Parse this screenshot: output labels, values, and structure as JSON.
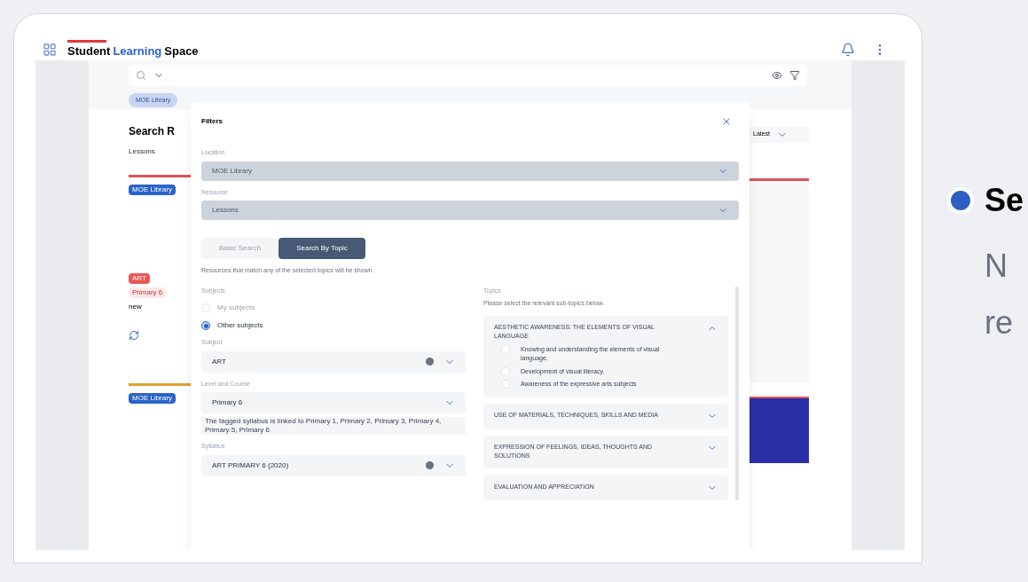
{
  "logo": {
    "prefix": "Student",
    "highlight": "Learning",
    "suffix": "Space"
  },
  "chips": [
    {
      "label": "MOE Library",
      "selected": true
    }
  ],
  "results": {
    "heading": "Search R",
    "tab": "Lessons",
    "sort": "Latest"
  },
  "cards_left": [
    {
      "badge": "MOE Library",
      "color": "#e05252",
      "tags": [
        {
          "label": "ART",
          "kind": "filled"
        },
        {
          "label": "Primary 6",
          "kind": "soft"
        }
      ],
      "note": "new"
    },
    {
      "badge": "MOE Library",
      "color": "#e0a030"
    }
  ],
  "filters": {
    "title": "Filters",
    "selects": [
      {
        "label": "Location",
        "value": "MOE Library",
        "disabled": true
      },
      {
        "label": "Resource",
        "value": "Lessons",
        "disabled": true
      }
    ],
    "tabs": [
      {
        "label": "Basic Search",
        "selected": false
      },
      {
        "label": "Search By Topic",
        "selected": true
      }
    ],
    "hint": "Resources that match any of the selected topics will be shown.",
    "subjects": {
      "label": "Subjects",
      "options": [
        {
          "label": "My subjects",
          "selected": false
        },
        {
          "label": "Other subjects",
          "selected": true
        }
      ]
    },
    "fields": [
      {
        "label": "Subject",
        "value": "ART",
        "clearable": true
      },
      {
        "label": "Level and Course",
        "value": "Primary 6",
        "clearable": false,
        "note": "The tagged syllabus is linked to Primary 1, Primary 2, Primary 3, Primary 4, Primary 5, Primary 6"
      },
      {
        "label": "Syllabus",
        "value": "ART PRIMARY 6 (2020)",
        "clearable": true
      }
    ],
    "topics": {
      "label": "Topics",
      "hint": "Please select the relevant sub-topics below.",
      "items": [
        {
          "title": "AESTHETIC AWARENESS: THE ELEMENTS OF VISUAL LANGUAGE",
          "expanded": true,
          "children": [
            {
              "label": "Knowing and understanding the elements of visual language.",
              "checked": false
            },
            {
              "label": "Development of visual literacy.",
              "checked": false
            },
            {
              "label": "Awareness of the expressive arts subjects",
              "checked": false
            }
          ]
        },
        {
          "title": "USE OF MATERIALS, TECHNIQUES, SKILLS AND MEDIA",
          "expanded": false
        },
        {
          "title": "EXPRESSION OF FEELINGS, IDEAS, THOUGHTS AND SOLUTIONS",
          "expanded": false
        },
        {
          "title": "EVALUATION AND APPRECIATION",
          "expanded": false
        }
      ]
    }
  },
  "side": {
    "heading": "Se",
    "lines": [
      "N",
      "re"
    ]
  }
}
